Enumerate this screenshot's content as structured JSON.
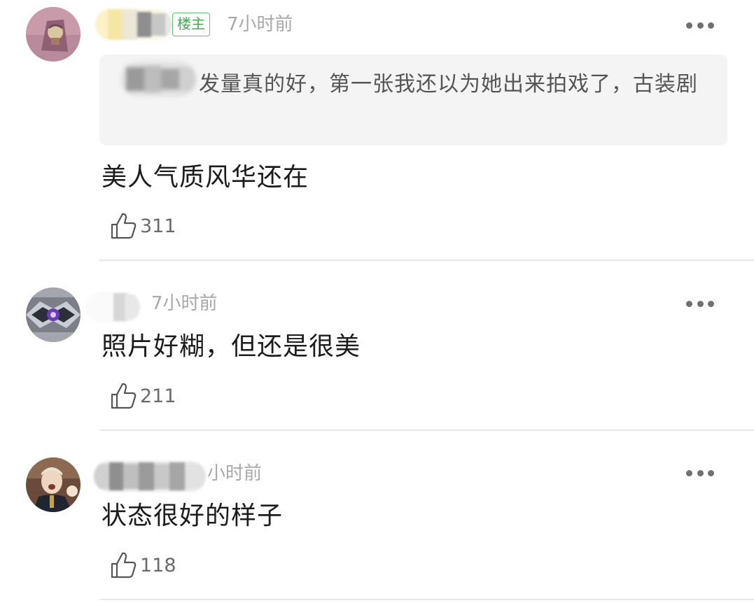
{
  "comments": [
    {
      "badge": "楼主",
      "time": "7小时前",
      "quote": "发量真的好，第一张我还以为她出来拍戏了，古装剧",
      "text": "美人气质风华还在",
      "likes": "311"
    },
    {
      "time": "7小时前",
      "text": "照片好糊，但还是很美",
      "likes": "211"
    },
    {
      "time": "小时前",
      "text": "状态很好的样子",
      "likes": "118"
    }
  ],
  "colors": {
    "badge_green": "#43a658",
    "time_gray": "#a8a8a8",
    "quote_bg": "#f4f4f4"
  },
  "icons": {
    "like": "thumbs-up-icon",
    "more": "more-dots-icon"
  }
}
